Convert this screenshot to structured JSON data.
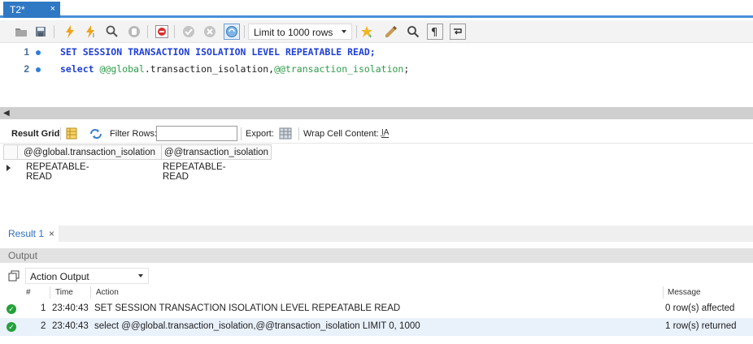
{
  "tab": {
    "title": "T2*",
    "close": "×"
  },
  "toolbar": {
    "icons": [
      "open-folder-icon",
      "save-icon",
      "execute-icon",
      "execute-current-icon",
      "explain-icon",
      "stop-icon",
      "toggle-errors-icon",
      "commit-icon",
      "rollback-icon",
      "autocommit-icon",
      "bookmark-icon",
      "beautify-icon",
      "find-icon",
      "invisible-chars-icon",
      "wrap-icon"
    ],
    "limit_label": "Limit to 1000 rows"
  },
  "editor": {
    "lines": [
      {
        "number": "1",
        "code": "SET SESSION TRANSACTION ISOLATION LEVEL REPEATABLE READ;"
      },
      {
        "number": "2",
        "kw": "select ",
        "var1": "@@global",
        "p1": ".transaction_isolation,",
        "var2": "@@transaction_isolation",
        "p2": ";"
      }
    ]
  },
  "result_toolbar": {
    "result_grid_label": "Result Grid",
    "filter_rows_label": "Filter Rows:",
    "filter_value": "",
    "export_label": "Export:",
    "wrap_label": "Wrap Cell Content:"
  },
  "grid": {
    "columns": [
      "@@global.transaction_isolation",
      "@@transaction_isolation"
    ],
    "rows": [
      [
        "REPEATABLE-READ",
        "REPEATABLE-READ"
      ]
    ]
  },
  "result_tab": {
    "label": "Result 1",
    "close": "×"
  },
  "output": {
    "title": "Output",
    "selector": "Action Output",
    "columns": {
      "num": "#",
      "time": "Time",
      "action": "Action",
      "message": "Message"
    },
    "rows": [
      {
        "num": "1",
        "time": "23:40:43",
        "action": "SET SESSION TRANSACTION ISOLATION LEVEL REPEATABLE READ",
        "message": "0 row(s) affected"
      },
      {
        "num": "2",
        "time": "23:40:43",
        "action": "select @@global.transaction_isolation,@@transaction_isolation LIMIT 0, 1000",
        "message": "1 row(s) returned"
      }
    ]
  },
  "colors": {
    "accent": "#2f78c4",
    "keyword": "#1f3fd6",
    "variable": "#2e9c4a",
    "success": "#23a13a"
  }
}
